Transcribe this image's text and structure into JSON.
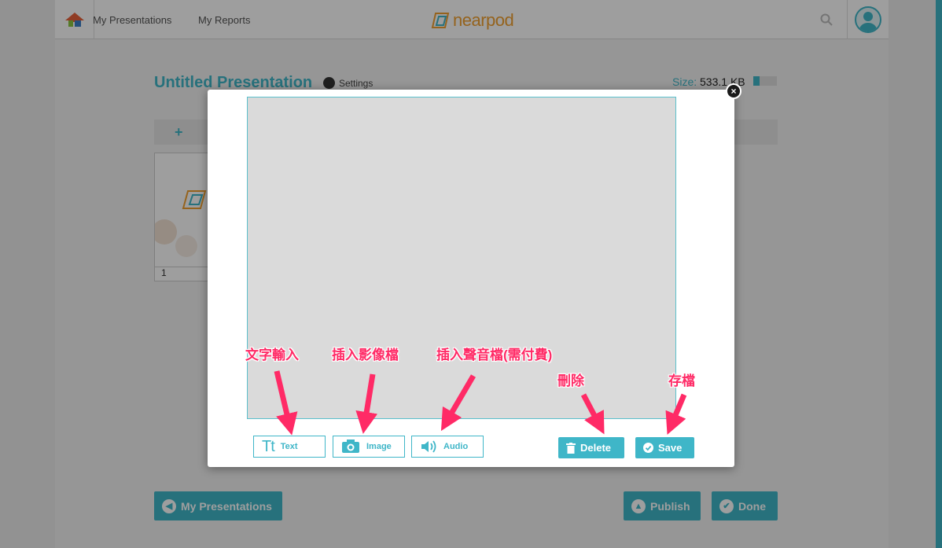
{
  "topbar": {
    "nav_presentations": "My Presentations",
    "nav_reports": "My Reports",
    "logo_text": "nearpod",
    "icons": [
      "home-icon",
      "search-icon",
      "user-avatar-icon"
    ]
  },
  "editor": {
    "title": "Untitled Presentation",
    "settings_label": "Settings",
    "size_label": "Size:",
    "size_value": "533.1 KB",
    "size_usage_fraction": 0.25,
    "add_label": "+",
    "slide_number": "1",
    "back_label": "My Presentations",
    "publish_label": "Publish",
    "done_label": "Done"
  },
  "modal": {
    "tools": {
      "text_label": "Text",
      "text_icon_glyph": "Tt",
      "image_label": "Image",
      "audio_label": "Audio"
    },
    "delete_label": "Delete",
    "save_label": "Save",
    "close_glyph": "×"
  },
  "annotations": {
    "text_input": "文字輸入",
    "insert_image": "插入影像檔",
    "insert_audio": "插入聲音檔(需付費)",
    "delete": "刪除",
    "save": "存檔"
  },
  "colors": {
    "accent": "#3fb6c8",
    "annotation": "#ff2a66",
    "logo": "#f0a030"
  }
}
